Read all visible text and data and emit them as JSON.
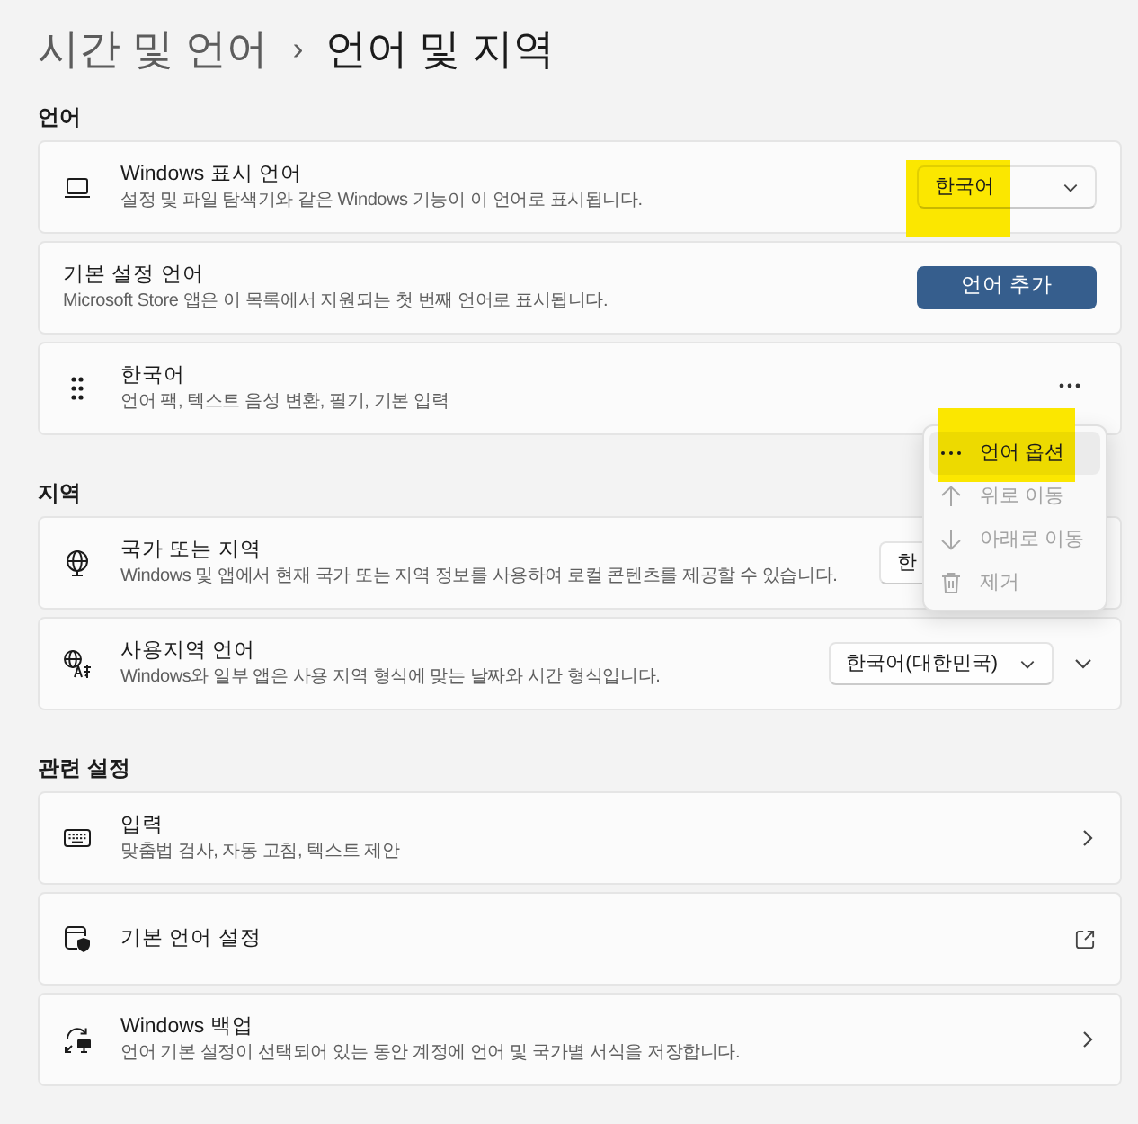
{
  "header": {
    "parent": "시간 및 언어",
    "separator": "›",
    "title": "언어 및 지역"
  },
  "sections": [
    {
      "heading": "언어",
      "cards": [
        {
          "title": "Windows 표시 언어",
          "subtitle": "설정 및 파일 탐색기와 같은 Windows 기능이 이 언어로 표시됩니다.",
          "control": {
            "kind": "dropdown",
            "value": "한국어",
            "highlighted": true
          }
        },
        {
          "title": "기본 설정 언어",
          "subtitle": "Microsoft Store 앱은 이 목록에서 지원되는 첫 번째 언어로 표시됩니다.",
          "control": {
            "kind": "button",
            "label": "언어 추가"
          }
        },
        {
          "title": "한국어",
          "subtitle": "언어 팩, 텍스트 음성 변환, 필기, 기본 입력",
          "control": {
            "kind": "more",
            "menu": [
              {
                "label": "언어 옵션",
                "disabled": false,
                "hovered": true,
                "highlighted": true
              },
              {
                "label": "위로 이동",
                "disabled": true,
                "hovered": false,
                "highlighted": false
              },
              {
                "label": "아래로 이동",
                "disabled": true,
                "hovered": false,
                "highlighted": false
              },
              {
                "label": "제거",
                "disabled": true,
                "hovered": false,
                "highlighted": false
              }
            ]
          }
        }
      ]
    },
    {
      "heading": "지역",
      "cards": [
        {
          "title": "국가 또는 지역",
          "subtitle": "Windows 및 앱에서 현재 국가 또는 지역 정보를 사용하여 로컬 콘텐츠를 제공할 수 있습니다.",
          "control": {
            "kind": "covered_dropdown",
            "value": "한",
            "highlighted": false
          }
        },
        {
          "title": "사용지역 언어",
          "subtitle": "Windows와 일부 앱은 사용 지역 형식에 맞는 날짜와 시간 형식입니다.",
          "control": {
            "kind": "dropdown_expand",
            "value": "한국어(대한민국)",
            "highlighted": false,
            "expanded": false
          }
        }
      ]
    },
    {
      "heading": "관련 설정",
      "cards": [
        {
          "title": "입력",
          "subtitle": "맞춤법 검사, 자동 고침, 텍스트 제안",
          "control": {
            "kind": "link"
          }
        },
        {
          "title": "기본 언어 설정",
          "control": {
            "kind": "external"
          }
        },
        {
          "title": "Windows 백업",
          "subtitle": "언어 기본 설정이 선택되어 있는 동안 계정에 언어 및 국가별 서식을 저장합니다.",
          "control": {
            "kind": "link"
          }
        }
      ]
    }
  ]
}
